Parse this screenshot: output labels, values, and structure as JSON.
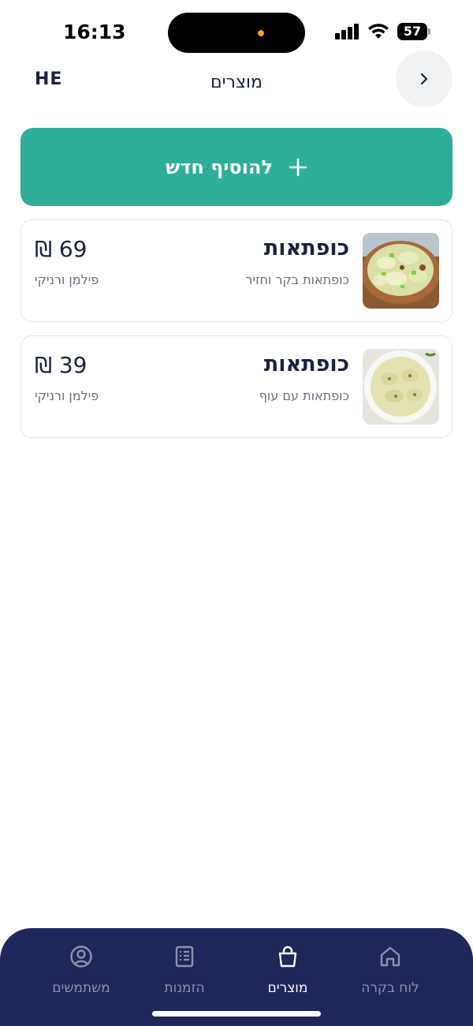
{
  "status_bar": {
    "time": "16:13",
    "battery": "57"
  },
  "header": {
    "lang": "HE",
    "title": "מוצרים"
  },
  "add_button": {
    "label": "להוסיף חדש"
  },
  "products": [
    {
      "name": "כופתאות",
      "description": "כופתאות בקר וחזיר",
      "price": "69 ₪",
      "category": "פילמן ורניקי"
    },
    {
      "name": "כופתאות",
      "description": "כופתאות עם עוף",
      "price": "39 ₪",
      "category": "פילמן ורניקי"
    }
  ],
  "nav": [
    {
      "label": "לוח בקרה",
      "icon": "home-icon",
      "active": false
    },
    {
      "label": "מוצרים",
      "icon": "shopping-bag-icon",
      "active": true
    },
    {
      "label": "הזמנות",
      "icon": "receipt-icon",
      "active": false
    },
    {
      "label": "משתמשים",
      "icon": "user-circle-icon",
      "active": false
    }
  ],
  "colors": {
    "accent": "#2eae98",
    "nav_bg": "#1f265a",
    "text_dark": "#1b2240",
    "text_muted": "#6b7080"
  }
}
